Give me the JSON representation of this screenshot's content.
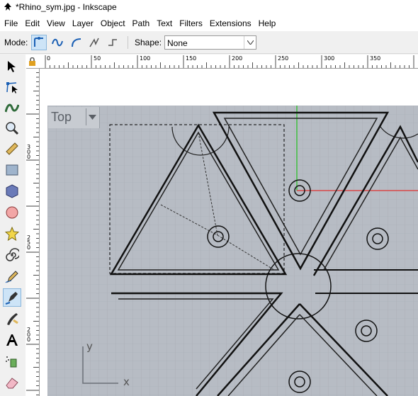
{
  "window": {
    "title": "*Rhino_sym.jpg - Inkscape"
  },
  "menu": [
    "File",
    "Edit",
    "View",
    "Layer",
    "Object",
    "Path",
    "Text",
    "Filters",
    "Extensions",
    "Help"
  ],
  "toolbar": {
    "mode_label": "Mode:",
    "shape_label": "Shape:",
    "shape_value": "None"
  },
  "ruler": {
    "h_labels": [
      "0",
      "50",
      "100",
      "150",
      "200",
      "250",
      "300",
      "350"
    ],
    "v_labels": [
      "300",
      "250",
      "200",
      "150"
    ]
  },
  "viewport": {
    "label": "Top",
    "axis_y": "y",
    "axis_x": "x"
  },
  "colors": {
    "accent": "#cde4f7",
    "canvas_bg": "#b7bcc4",
    "axis_green": "#3fbf3f",
    "axis_red": "#d84a4a"
  }
}
